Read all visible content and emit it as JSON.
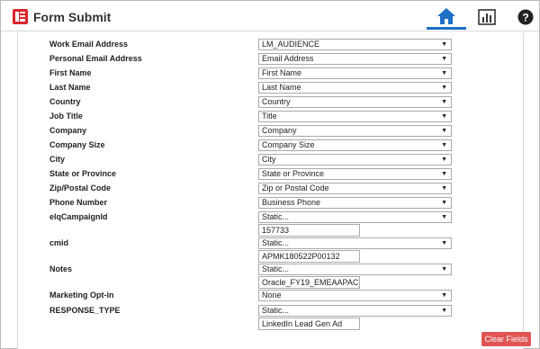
{
  "header": {
    "title": "Form Submit",
    "icons": {
      "app": "form-submit-app-icon",
      "home": "home-icon",
      "chart": "chart-icon",
      "help": "help-icon"
    },
    "accent_color": "#1f6fc5"
  },
  "form": {
    "rows": [
      {
        "label": "Work Email Address",
        "select": "LM_AUDIENCE"
      },
      {
        "label": "Personal Email Address",
        "select": "Email Address"
      },
      {
        "label": "First Name",
        "select": "First Name"
      },
      {
        "label": "Last Name",
        "select": "Last Name"
      },
      {
        "label": "Country",
        "select": "Country"
      },
      {
        "label": "Job Title",
        "select": "Title"
      },
      {
        "label": "Company",
        "select": "Company"
      },
      {
        "label": "Company Size",
        "select": "Company Size"
      },
      {
        "label": "City",
        "select": "City"
      },
      {
        "label": "State or Province",
        "select": "State or Province"
      },
      {
        "label": "Zip/Postal Code",
        "select": "Zip or Postal Code"
      },
      {
        "label": "Phone Number",
        "select": "Business Phone"
      },
      {
        "label": "elqCampaignId",
        "select": "Static...",
        "text": "157733"
      },
      {
        "label": "cmid",
        "select": "Static...",
        "text": "APMK180522P00132"
      },
      {
        "label": "Notes",
        "select": "Static...",
        "text": "Oracle_FY19_EMEAAPAC_"
      },
      {
        "label": "Marketing Opt-in",
        "select": "None"
      },
      {
        "label": "RESPONSE_TYPE",
        "select": "Static...",
        "text": "LinkedIn Lead Gen Ad"
      }
    ]
  },
  "actions": {
    "clear_label": "Clear Fields",
    "clear_color": "#e05454"
  }
}
